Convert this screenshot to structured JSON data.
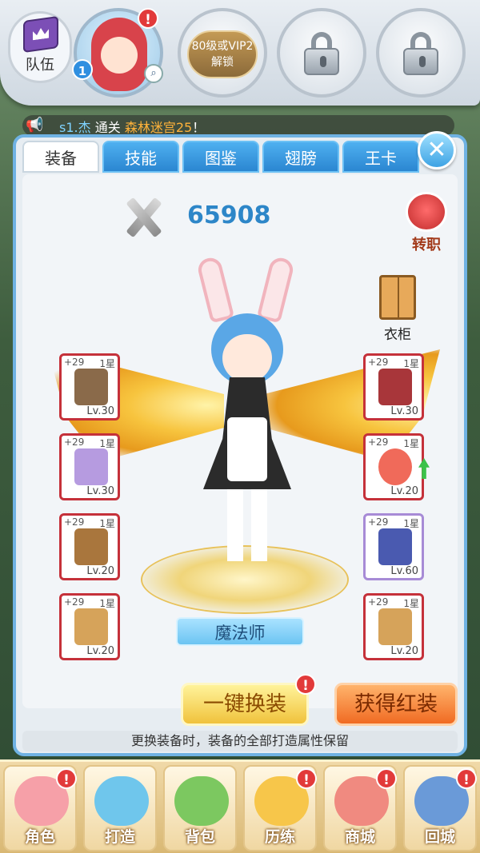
{
  "party": {
    "team_label": "队伍",
    "hero_level_badge": "1",
    "hero_zoom_symbol": "⌕",
    "slot3_unlock_line1": "80级或VIP2",
    "slot3_unlock_line2": "解锁",
    "alert_symbol": "!"
  },
  "announcement": {
    "player_prefix": "s1.",
    "player_name": "杰",
    "action": " 通关 ",
    "place": "森林迷宫25",
    "suffix": "！"
  },
  "tabs": [
    {
      "label": "装备",
      "active": true
    },
    {
      "label": "技能",
      "active": false
    },
    {
      "label": "图鉴",
      "active": false
    },
    {
      "label": "翅膀",
      "active": false
    },
    {
      "label": "王卡",
      "active": false
    }
  ],
  "close_symbol": "✕",
  "power_value": "65908",
  "job_change_label": "转职",
  "wardrobe_label": "衣柜",
  "class_name": "魔法师",
  "equipment_left": [
    {
      "plus": "+29",
      "star": "1星",
      "level": "Lv.30",
      "icon": "staff-icon",
      "color": "#8a6a4a"
    },
    {
      "plus": "+29",
      "star": "1星",
      "level": "Lv.30",
      "icon": "robe-icon",
      "color": "#b69be0"
    },
    {
      "plus": "+29",
      "star": "1星",
      "level": "Lv.20",
      "icon": "cape-icon",
      "color": "#a9763d"
    },
    {
      "plus": "+29",
      "star": "1星",
      "level": "Lv.20",
      "icon": "glove-icon",
      "color": "#d6a35a"
    }
  ],
  "equipment_right": [
    {
      "plus": "+29",
      "star": "1星",
      "level": "Lv.30",
      "icon": "spellbook-icon",
      "color": "#a8363a"
    },
    {
      "plus": "+29",
      "star": "1星",
      "level": "Lv.20",
      "icon": "ring-icon",
      "color": "#f06a5a"
    },
    {
      "plus": "+29",
      "star": "1星",
      "level": "Lv.60",
      "icon": "boots-icon",
      "color": "#4a5ab0"
    },
    {
      "plus": "+29",
      "star": "1星",
      "level": "Lv.20",
      "icon": "glove-icon",
      "color": "#d6a35a"
    }
  ],
  "buttons": {
    "one_key_equip": "一键换装",
    "get_red_gear": "获得红装"
  },
  "hint": "更换装备时，装备的全部打造属性保留",
  "nav": [
    {
      "label": "角色",
      "icon": "role-icon",
      "color": "#f6a0a8",
      "alert": true
    },
    {
      "label": "打造",
      "icon": "forge-icon",
      "color": "#6fc6ec",
      "alert": false
    },
    {
      "label": "背包",
      "icon": "bag-icon",
      "color": "#7cc860",
      "alert": false
    },
    {
      "label": "历练",
      "icon": "training-icon",
      "color": "#f7c64a",
      "alert": true
    },
    {
      "label": "商城",
      "icon": "shop-icon",
      "color": "#f08a80",
      "alert": true
    },
    {
      "label": "回城",
      "icon": "castle-icon",
      "color": "#6a9ad8",
      "alert": true
    }
  ]
}
